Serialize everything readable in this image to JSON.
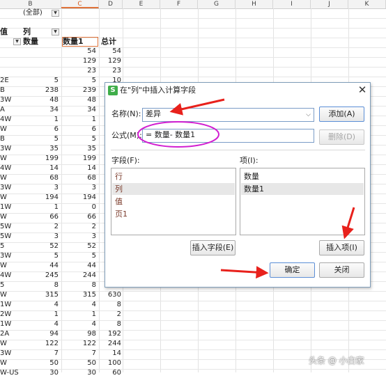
{
  "columns": [
    "B",
    "C",
    "D",
    "E",
    "F",
    "G",
    "H",
    "I",
    "J",
    "K"
  ],
  "pivot": {
    "filter_value": "(全部)",
    "header_row": {
      "a": "值",
      "b": "列"
    },
    "subheader": {
      "b": "数量",
      "c": "数量1",
      "d": "总计"
    },
    "rows": [
      {
        "a": "",
        "b": "",
        "c": "54",
        "d": "54"
      },
      {
        "a": "",
        "b": "",
        "c": "129",
        "d": "129"
      },
      {
        "a": "",
        "b": "",
        "c": "23",
        "d": "23"
      },
      {
        "a": "2E",
        "b": "5",
        "c": "5",
        "d": "10"
      },
      {
        "a": "B",
        "b": "238",
        "c": "239",
        "d": ""
      },
      {
        "a": "3W",
        "b": "48",
        "c": "48",
        "d": ""
      },
      {
        "a": "A",
        "b": "34",
        "c": "34",
        "d": ""
      },
      {
        "a": "4W",
        "b": "1",
        "c": "1",
        "d": ""
      },
      {
        "a": "W",
        "b": "6",
        "c": "6",
        "d": ""
      },
      {
        "a": "B",
        "b": "5",
        "c": "5",
        "d": ""
      },
      {
        "a": "3W",
        "b": "35",
        "c": "35",
        "d": ""
      },
      {
        "a": "W",
        "b": "199",
        "c": "199",
        "d": ""
      },
      {
        "a": "4W",
        "b": "14",
        "c": "14",
        "d": ""
      },
      {
        "a": "W",
        "b": "68",
        "c": "68",
        "d": ""
      },
      {
        "a": "3W",
        "b": "3",
        "c": "3",
        "d": ""
      },
      {
        "a": "W",
        "b": "194",
        "c": "194",
        "d": ""
      },
      {
        "a": "1W",
        "b": "1",
        "c": "0",
        "d": ""
      },
      {
        "a": "W",
        "b": "66",
        "c": "66",
        "d": ""
      },
      {
        "a": "5W",
        "b": "2",
        "c": "2",
        "d": ""
      },
      {
        "a": "5W",
        "b": "3",
        "c": "3",
        "d": ""
      },
      {
        "a": "5",
        "b": "52",
        "c": "52",
        "d": ""
      },
      {
        "a": "3W",
        "b": "5",
        "c": "5",
        "d": ""
      },
      {
        "a": "W",
        "b": "44",
        "c": "44",
        "d": ""
      },
      {
        "a": "4W",
        "b": "245",
        "c": "244",
        "d": ""
      },
      {
        "a": "5",
        "b": "8",
        "c": "8",
        "d": ""
      },
      {
        "a": "W",
        "b": "315",
        "c": "315",
        "d": "630"
      },
      {
        "a": "1W",
        "b": "4",
        "c": "4",
        "d": "8"
      },
      {
        "a": "2W",
        "b": "1",
        "c": "1",
        "d": "2"
      },
      {
        "a": "1W",
        "b": "4",
        "c": "4",
        "d": "8"
      },
      {
        "a": "2A",
        "b": "94",
        "c": "98",
        "d": "192"
      },
      {
        "a": "W",
        "b": "122",
        "c": "122",
        "d": "244"
      },
      {
        "a": "3W",
        "b": "7",
        "c": "7",
        "d": "14"
      },
      {
        "a": "W",
        "b": "50",
        "c": "50",
        "d": "100"
      },
      {
        "a": "W-US",
        "b": "30",
        "c": "30",
        "d": "60"
      }
    ]
  },
  "dialog": {
    "title": "在\"列\"中插入计算字段",
    "name_label": "名称(N):",
    "name_value": "差异",
    "formula_label": "公式(M):",
    "formula_value": "= 数量- 数量1",
    "fields_label": "字段(F):",
    "fields": [
      "行",
      "列",
      "值",
      "页1"
    ],
    "items_label": "项(I):",
    "items": [
      "数量",
      "数量1"
    ],
    "add_button": "添加(A)",
    "delete_button": "删除(D)",
    "insert_field_button": "插入字段(E)",
    "insert_item_button": "插入项(I)",
    "ok_button": "确定",
    "close_button": "关闭"
  },
  "watermark": "头条 @ 小白家",
  "colors": {
    "accent_red": "#e8211c",
    "annotation_magenta": "#d21fd1",
    "field_text": "#7a3a2a"
  }
}
